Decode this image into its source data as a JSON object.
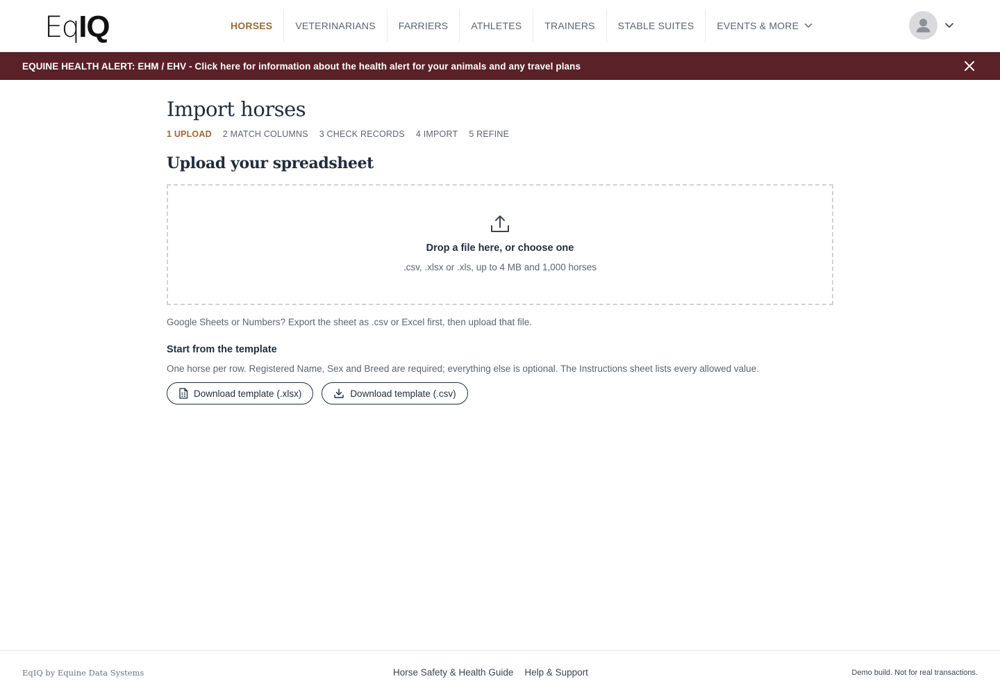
{
  "header": {
    "logo_part1": "Eq",
    "logo_part2": "IQ",
    "nav": [
      {
        "label": "HORSES"
      },
      {
        "label": "VETERINARIANS"
      },
      {
        "label": "FARRIERS"
      },
      {
        "label": "ATHLETES"
      },
      {
        "label": "TRAINERS"
      },
      {
        "label": "STABLE SUITES"
      },
      {
        "label": "EVENTS & MORE"
      }
    ],
    "active_nav": "HORSES",
    "accent_color": "#9b6a33"
  },
  "alert": {
    "text": "EQUINE HEALTH ALERT: EHM / EHV - Click here for information about the health alert for your animals and any travel plans",
    "background_color": "#5a2128"
  },
  "main": {
    "title": "Import horses",
    "steps": [
      {
        "label": "1 UPLOAD"
      },
      {
        "label": "2 MATCH COLUMNS"
      },
      {
        "label": "3 CHECK RECORDS"
      },
      {
        "label": "4 IMPORT"
      },
      {
        "label": "5 REFINE"
      }
    ],
    "active_step": "1 UPLOAD",
    "section_title": "Upload your spreadsheet",
    "dropzone": {
      "title": "Drop a file here, or choose one",
      "hint": ".csv, .xlsx or .xls, up to 4 MB and 1,000 horses"
    },
    "note": "Google Sheets or Numbers? Export the sheet as .csv or Excel first, then upload that file.",
    "template": {
      "heading": "Start from the template",
      "description": "One horse per row. Registered Name, Sex and Breed are required; everything else is optional. The Instructions sheet lists every allowed value.",
      "buttons": [
        {
          "label": "Download template (.xlsx)",
          "icon": "spreadsheet-file-icon"
        },
        {
          "label": "Download template (.csv)",
          "icon": "download-icon"
        }
      ]
    }
  },
  "footer": {
    "brand": "EqIQ by Equine Data Systems",
    "links": [
      {
        "label": "Horse Safety & Health Guide"
      },
      {
        "label": "Help & Support"
      }
    ],
    "note": "Demo build. Not for real transactions."
  }
}
